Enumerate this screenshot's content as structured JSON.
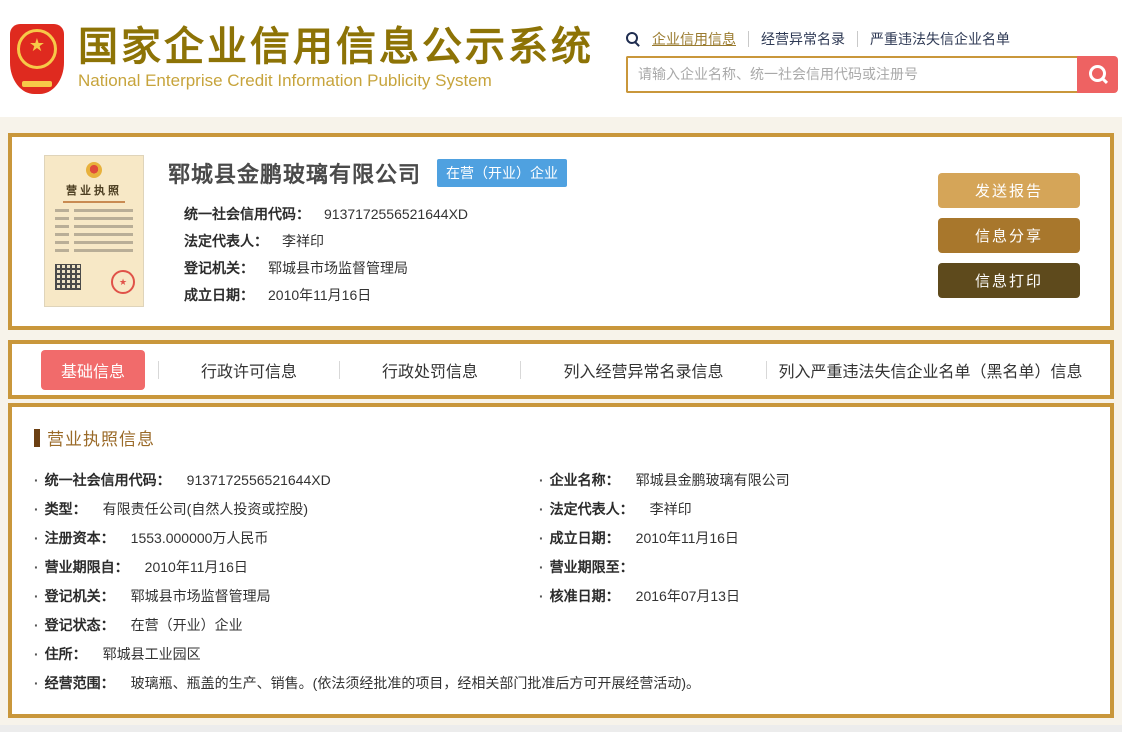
{
  "header": {
    "title_cn": "国家企业信用信息公示系统",
    "title_en": "National Enterprise Credit Information Publicity System",
    "nav": [
      {
        "label": "企业信用信息",
        "active": true
      },
      {
        "label": "经营异常名录",
        "active": false
      },
      {
        "label": "严重违法失信企业名单",
        "active": false
      }
    ],
    "search": {
      "placeholder": "请输入企业名称、统一社会信用代码或注册号",
      "value": ""
    }
  },
  "company": {
    "license_thumb_title": "营业执照",
    "name": "郓城县金鹏玻璃有限公司",
    "status_badge": "在营（开业）企业",
    "fields": [
      {
        "label": "统一社会信用代码：",
        "value": "9137172556521644XD"
      },
      {
        "label": "法定代表人：",
        "value": "李祥印"
      },
      {
        "label": "登记机关：",
        "value": "郓城县市场监督管理局"
      },
      {
        "label": "成立日期：",
        "value": "2010年11月16日"
      }
    ],
    "action_buttons": [
      "发送报告",
      "信息分享",
      "信息打印"
    ]
  },
  "tabs": [
    {
      "label": "基础信息",
      "active": true
    },
    {
      "label": "行政许可信息",
      "active": false
    },
    {
      "label": "行政处罚信息",
      "active": false
    },
    {
      "label": "列入经营异常名录信息",
      "active": false
    },
    {
      "label": "列入严重违法失信企业名单（黑名单）信息",
      "active": false
    }
  ],
  "license_info": {
    "section_title": "营业执照信息",
    "left": [
      {
        "label": "统一社会信用代码：",
        "value": "9137172556521644XD"
      },
      {
        "label": "类型：",
        "value": "有限责任公司(自然人投资或控股)"
      },
      {
        "label": "注册资本：",
        "value": "1553.000000万人民币"
      },
      {
        "label": "营业期限自：",
        "value": "2010年11月16日"
      },
      {
        "label": "登记机关：",
        "value": "郓城县市场监督管理局"
      },
      {
        "label": "登记状态：",
        "value": "在营（开业）企业"
      }
    ],
    "right": [
      {
        "label": "企业名称：",
        "value": "郓城县金鹏玻璃有限公司"
      },
      {
        "label": "法定代表人：",
        "value": "李祥印"
      },
      {
        "label": "成立日期：",
        "value": "2010年11月16日"
      },
      {
        "label": "营业期限至：",
        "value": ""
      },
      {
        "label": "核准日期：",
        "value": "2016年07月13日"
      }
    ],
    "full": [
      {
        "label": "住所：",
        "value": "郓城县工业园区"
      },
      {
        "label": "经营范围：",
        "value": "玻璃瓶、瓶盖的生产、销售。(依法须经批准的项目，经相关部门批准后方可开展经营活动)。"
      }
    ]
  },
  "colors": {
    "accent_gold_border": "#C9973B",
    "title_gold": "#8D7306",
    "active_tab_red": "#F16B6B",
    "search_button_red": "#EE6262",
    "status_badge_blue": "#4FA1E0",
    "button_light": "#D5A558",
    "button_medium": "#A8772C",
    "button_dark": "#5E4A1C"
  }
}
